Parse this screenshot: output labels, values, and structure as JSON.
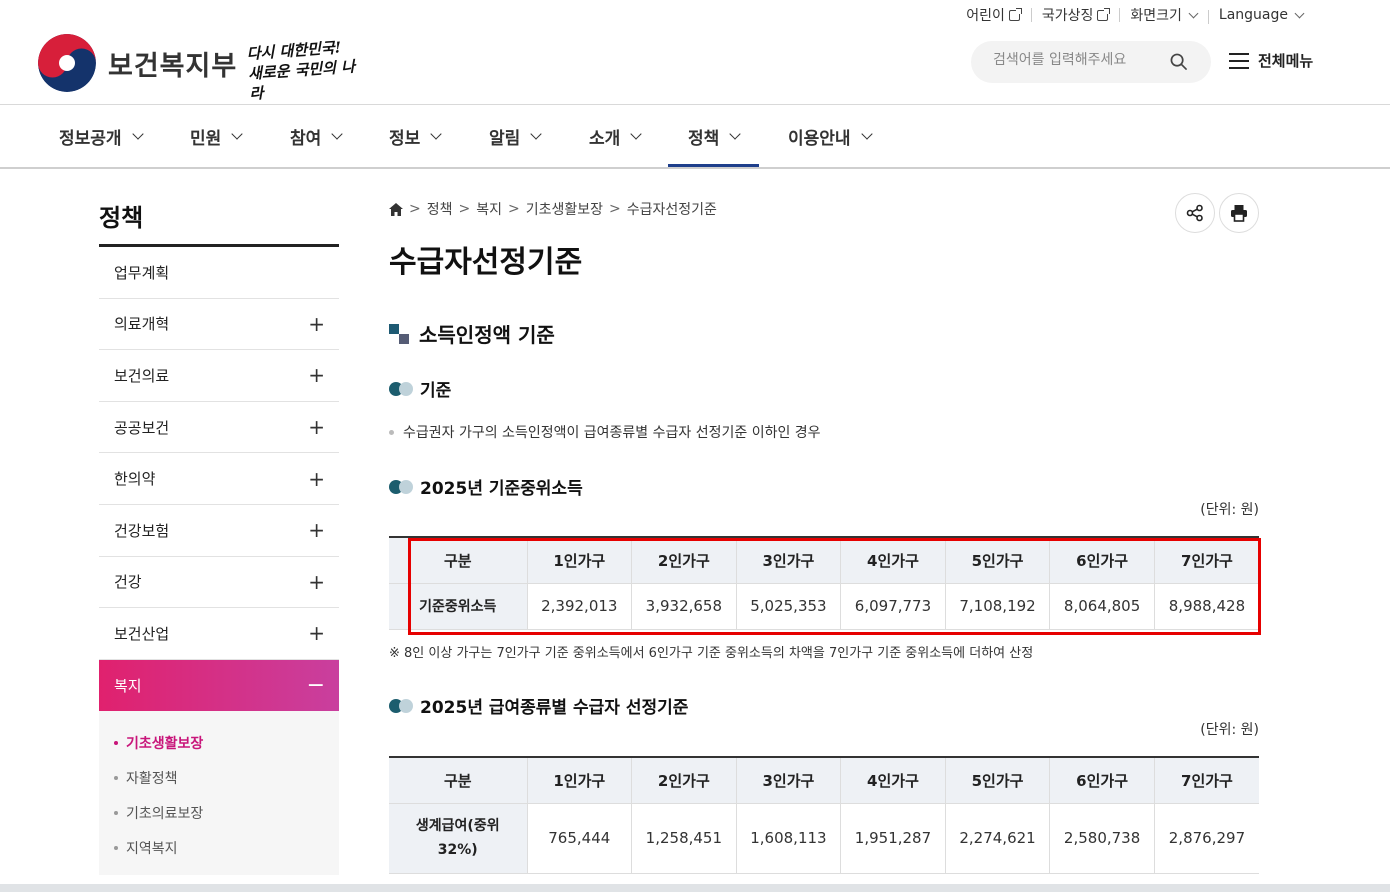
{
  "utility": {
    "items": [
      {
        "label": "어린이",
        "icon": "external-link-icon"
      },
      {
        "label": "국가상징",
        "icon": "external-link-icon"
      },
      {
        "label": "화면크기",
        "icon": "chevron-down-icon"
      },
      {
        "label": "Language",
        "icon": "chevron-down-icon"
      }
    ]
  },
  "header": {
    "brand": "보건복지부",
    "slogan_line1": "다시 대한민국!",
    "slogan_line2": "새로운 국민의 나라",
    "search_placeholder": "검색어를 입력해주세요",
    "all_menu_label": "전체메뉴"
  },
  "gnb": [
    "정보공개",
    "민원",
    "참여",
    "정보",
    "알림",
    "소개",
    "정책",
    "이용안내"
  ],
  "gnb_active": "정책",
  "sidebar": {
    "title": "정책",
    "items": [
      "업무계획",
      "의료개혁",
      "보건의료",
      "공공보건",
      "한의약",
      "건강보험",
      "건강",
      "보건산업",
      "복지"
    ],
    "expand_symbol": "+",
    "collapse_symbol": "−",
    "sub_items": [
      "기초생활보장",
      "자활정책",
      "기초의료보장",
      "지역복지"
    ]
  },
  "breadcrumb": [
    "정책",
    "복지",
    "기초생활보장",
    "수급자선정기준"
  ],
  "page_title": "수급자선정기준",
  "section1": {
    "heading": "소득인정액 기준",
    "sub1": "기준",
    "criteria_text": "수급권자 가구의 소득인정액이 급여종류별 수급자 선정기준 이하인 경우",
    "sub2": "2025년 기준중위소득",
    "unit": "(단위: 원)",
    "table": {
      "headers": [
        "구분",
        "1인가구",
        "2인가구",
        "3인가구",
        "4인가구",
        "5인가구",
        "6인가구",
        "7인가구"
      ],
      "row_label": "기준중위소득",
      "values": [
        "2,392,013",
        "3,932,658",
        "5,025,353",
        "6,097,773",
        "7,108,192",
        "8,064,805",
        "8,988,428"
      ]
    },
    "note": "※ 8인 이상 가구는 7인가구 기준 중위소득에서 6인가구 기준 중위소득의 차액을 7인가구 기준 중위소득에 더하여 산정"
  },
  "section2": {
    "heading": "2025년 급여종류별 수급자 선정기준",
    "unit": "(단위: 원)",
    "table": {
      "headers": [
        "구분",
        "1인가구",
        "2인가구",
        "3인가구",
        "4인가구",
        "5인가구",
        "6인가구",
        "7인가구"
      ],
      "row_label_line1": "생계급여(중위",
      "row_label_line2": "32%)",
      "values": [
        "765,444",
        "1,258,451",
        "1,608,113",
        "1,951,287",
        "2,274,621",
        "2,580,738",
        "2,876,297"
      ]
    }
  },
  "colors": {
    "accent_navy": "#1e3f8b",
    "sidebar_active_start": "#e0216e",
    "sidebar_active_end": "#c93f9e",
    "highlight_box": "#e60000"
  }
}
